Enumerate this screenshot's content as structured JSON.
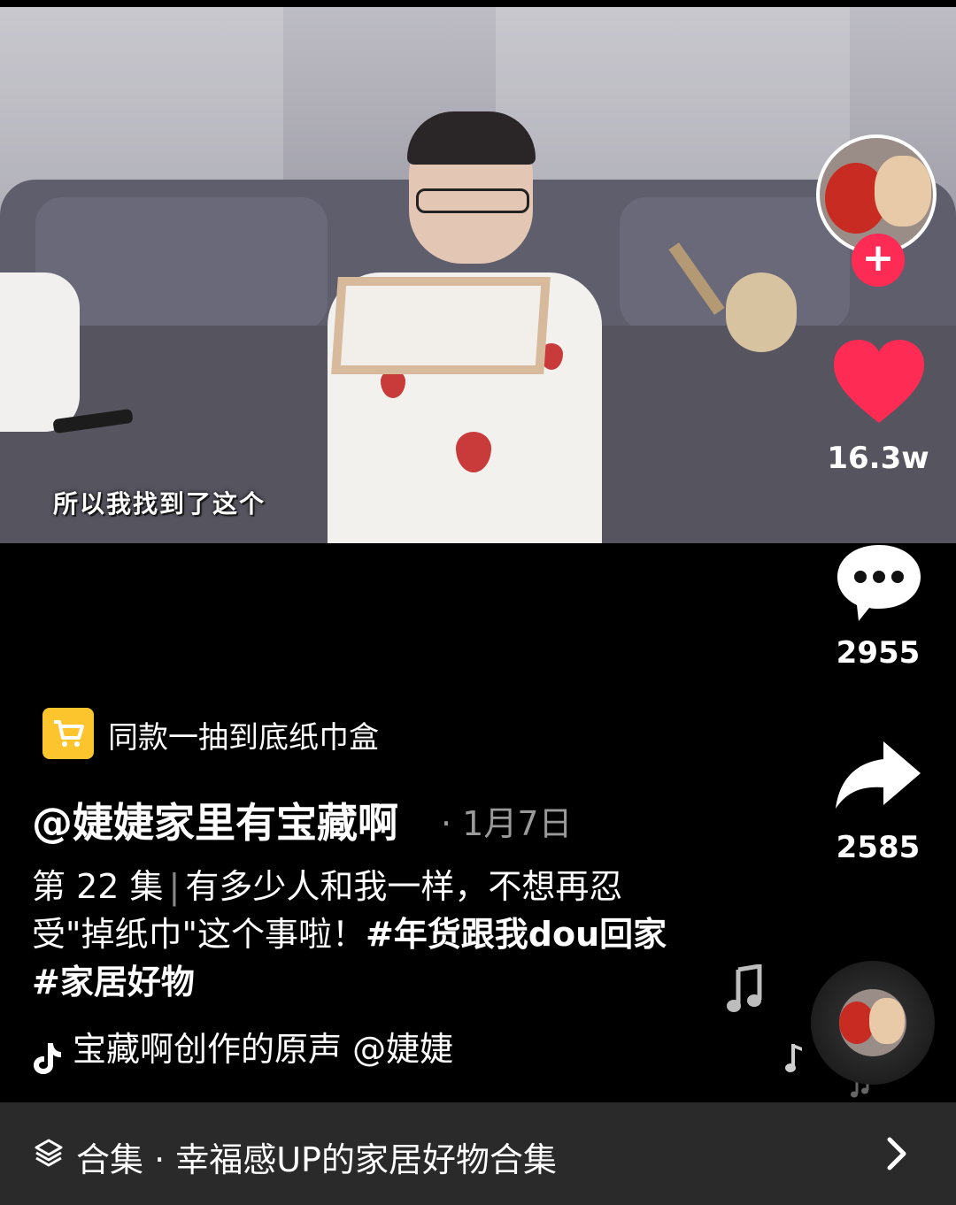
{
  "video": {
    "subtitle": "所以我找到了这个"
  },
  "rail": {
    "follow_symbol": "+",
    "like_count": "16.3w",
    "comment_count": "2955",
    "share_count": "2585",
    "icons": [
      "avatar",
      "heart-icon",
      "comment-icon",
      "share-icon",
      "music-disc"
    ]
  },
  "product": {
    "label": "同款一抽到底纸巾盒",
    "icon": "cart-icon"
  },
  "post": {
    "author": "@婕婕家里有宝藏啊",
    "date": "· 1月7日",
    "episode": "第 22 集",
    "separator": "|",
    "text": "有多少人和我一样，不想再忍受\"掉纸巾\"这个事啦！",
    "hashtag1": "#年货跟我dou回家",
    "hashtag2": "#家居好物"
  },
  "music": {
    "text": "宝藏啊创作的原声    @婕婕"
  },
  "collection": {
    "label": "合集 · 幸福感UP的家居好物合集"
  },
  "colors": {
    "like": "#fe2c55",
    "cart": "#fcc52d",
    "bar": "#2a2a2a"
  }
}
